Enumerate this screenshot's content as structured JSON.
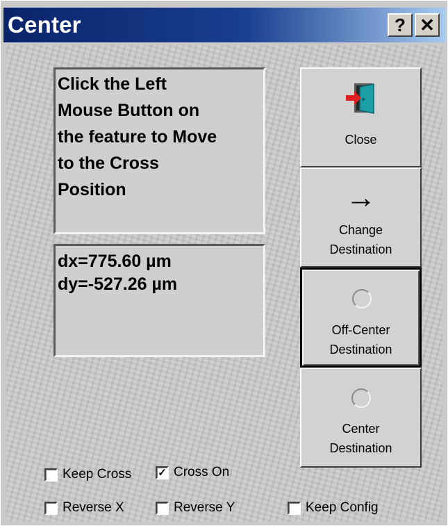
{
  "window": {
    "title": "Center",
    "help_label": "?",
    "close_label": "✕"
  },
  "instruction": {
    "lines": [
      "Click the Left",
      "Mouse Button on",
      "the feature to Move",
      "to the Cross",
      "Position"
    ]
  },
  "readout": {
    "dx": "dx=775.60 µm",
    "dy": "dy=-527.26 µm"
  },
  "buttons": {
    "close": {
      "label": "Close",
      "icon": "exit-door-icon"
    },
    "change_destination": {
      "line1": "Change",
      "line2": "Destination",
      "icon": "right-arrow-icon",
      "glyph": "→"
    },
    "off_center": {
      "line1": "Off-Center",
      "line2": "Destination",
      "icon": "radio-indicator-icon",
      "selected": true
    },
    "center": {
      "line1": "Center",
      "line2": "Destination",
      "icon": "radio-indicator-icon",
      "selected": false
    }
  },
  "options": {
    "keep_cross": {
      "label": "Keep Cross",
      "checked": false
    },
    "cross_on": {
      "label": "Cross On",
      "checked": true,
      "mark": "✓"
    },
    "reverse_x": {
      "label": "Reverse X",
      "checked": false
    },
    "reverse_y": {
      "label": "Reverse Y",
      "checked": false
    },
    "keep_config": {
      "label": "Keep Config",
      "checked": false
    }
  },
  "colors": {
    "titlebar_start": "#0a246a",
    "titlebar_end": "#a6caf0",
    "door": "#1a9ea8",
    "arrow": "#e02020"
  }
}
